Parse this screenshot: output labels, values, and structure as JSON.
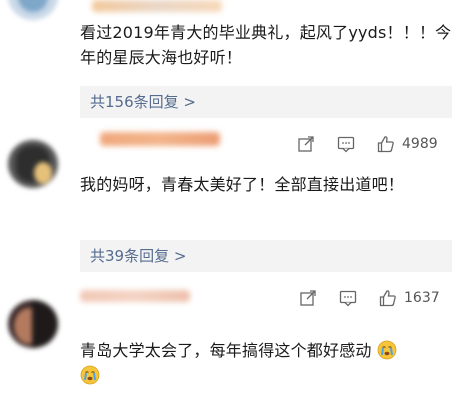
{
  "comments": [
    {
      "text": "看过2019年青大的毕业典礼，起风了yyds！！！今年的星辰大海也好听！",
      "replies_label": "共156条回复 >"
    },
    {
      "likes": "4989",
      "text": "我的妈呀，青春太美好了！全部直接出道吧！",
      "replies_label": "共39条回复 >"
    },
    {
      "likes": "1637",
      "text": "青岛大学太会了，每年搞得这个都好感动"
    }
  ],
  "icons": {
    "share": "share-icon",
    "comment": "comment-icon",
    "like": "thumbs-up-icon",
    "emoji": "crying-face-emoji"
  }
}
